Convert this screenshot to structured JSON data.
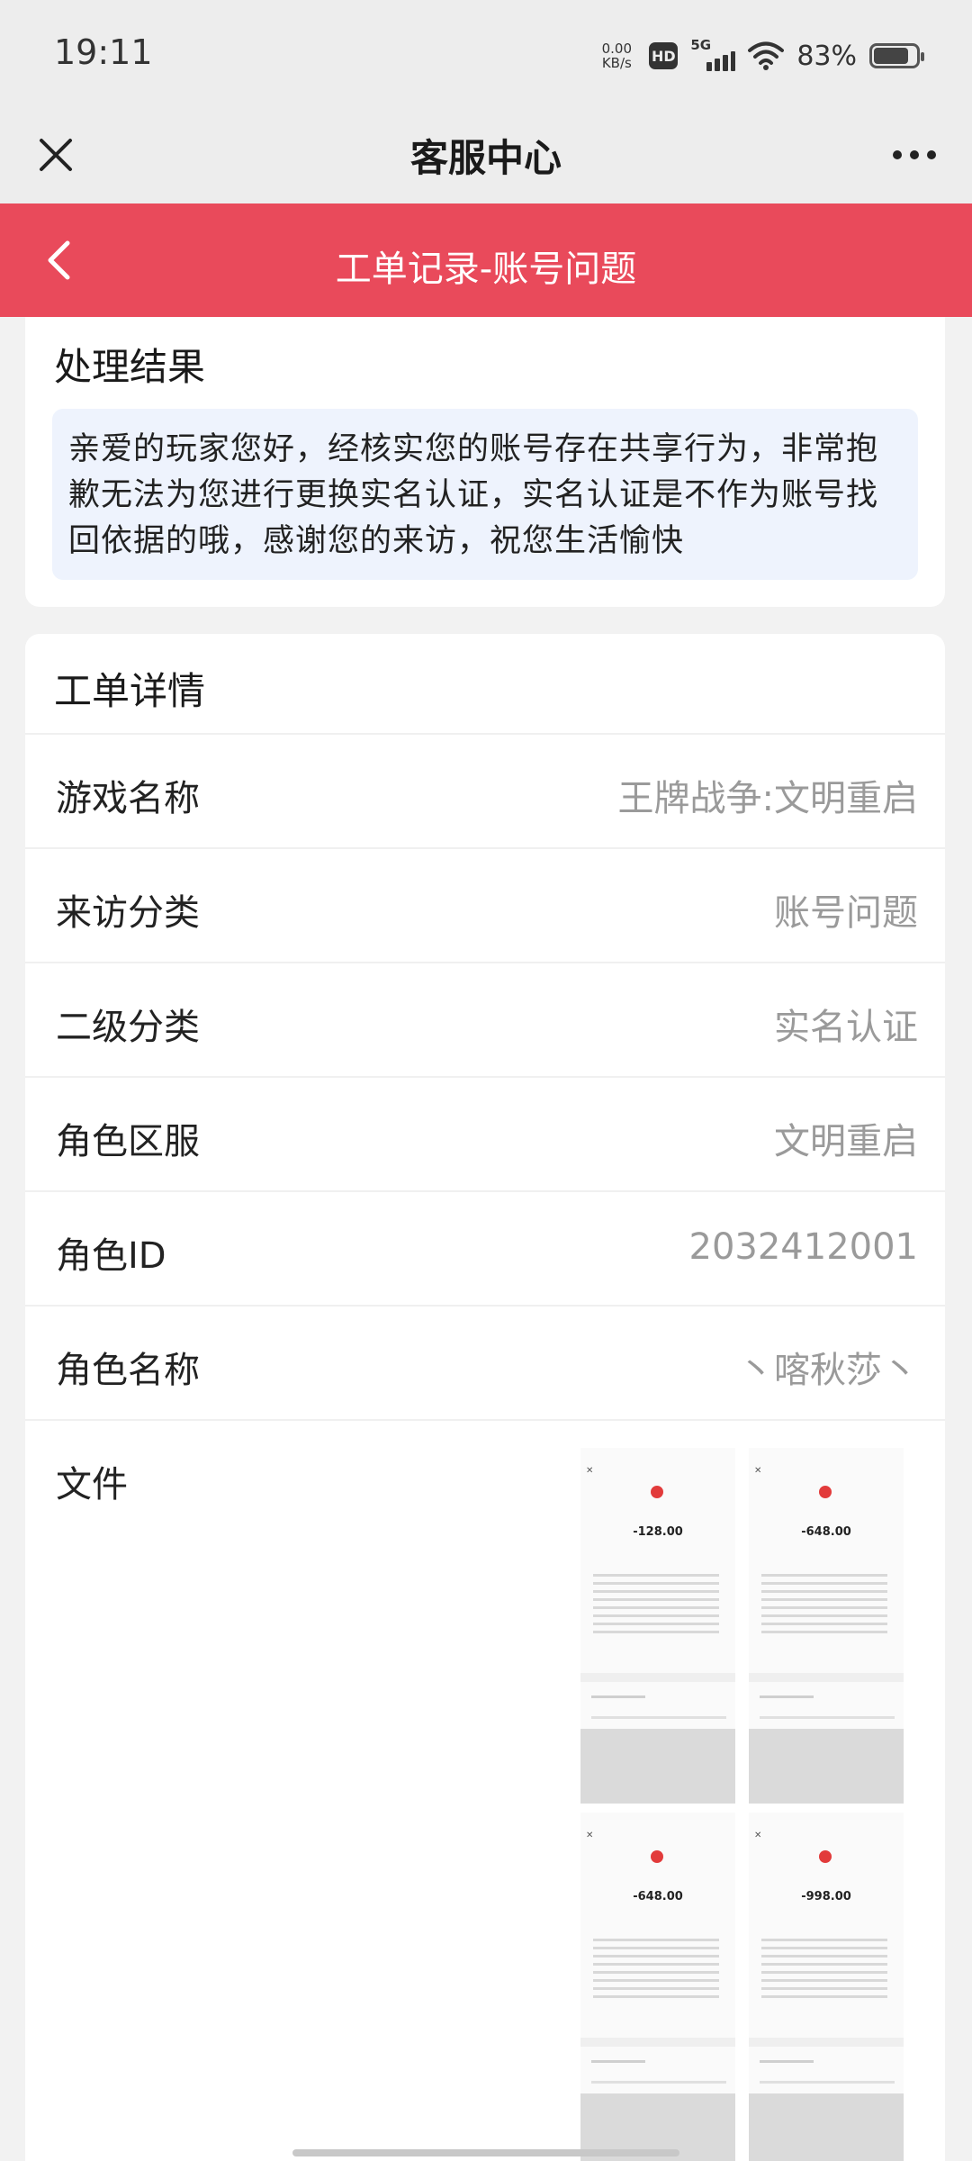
{
  "status_bar": {
    "time": "19:11",
    "net_speed_value": "0.00",
    "net_speed_unit": "KB/s",
    "hd": "HD",
    "network": "5G",
    "battery": "83%",
    "battery_level": 0.83
  },
  "nav": {
    "title": "客服中心",
    "close_icon": "close-icon",
    "more_icon": "more-icon"
  },
  "header": {
    "title": "工单记录-账号问题",
    "back_icon": "chevron-left-icon",
    "color": "#e94a5b"
  },
  "result": {
    "title": "处理结果",
    "text": "亲爱的玩家您好，经核实您的账号存在共享行为，非常抱歉无法为您进行更换实名认证，实名认证是不作为账号找回依据的哦，感谢您的来访，祝您生活愉快"
  },
  "details": {
    "title": "工单详情",
    "rows": [
      {
        "label": "游戏名称",
        "value": "王牌战争:文明重启"
      },
      {
        "label": "来访分类",
        "value": "账号问题"
      },
      {
        "label": "二级分类",
        "value": "实名认证"
      },
      {
        "label": "角色区服",
        "value": "文明重启"
      },
      {
        "label": "角色ID",
        "value": "2032412001"
      },
      {
        "label": "角色名称",
        "value": "丶喀秋莎丶"
      }
    ],
    "files_label": "文件",
    "files": [
      {
        "amount": "-128.00"
      },
      {
        "amount": "-648.00"
      },
      {
        "amount": "-648.00"
      },
      {
        "amount": "-998.00"
      }
    ]
  }
}
